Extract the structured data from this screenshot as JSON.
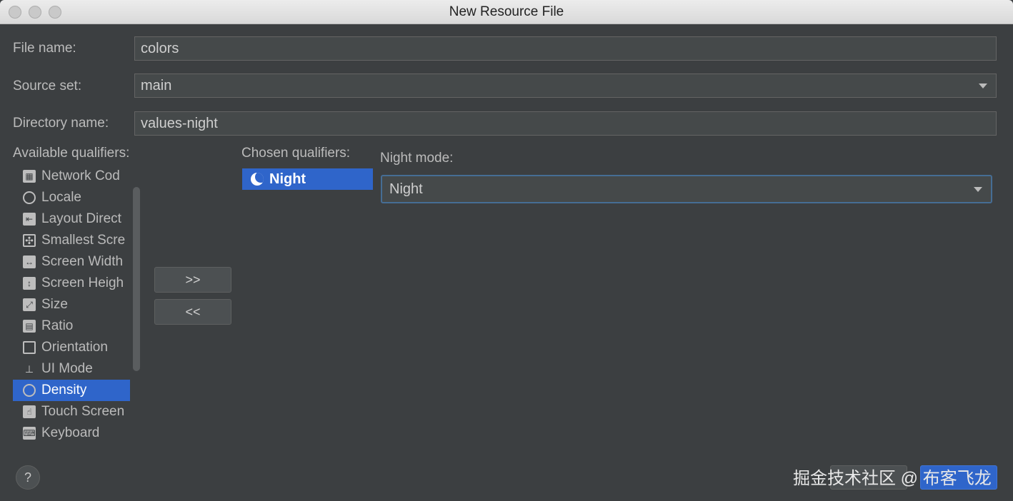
{
  "window": {
    "title": "New Resource File"
  },
  "form": {
    "file_name_label": "File name:",
    "file_name_value": "colors",
    "source_set_label": "Source set:",
    "source_set_value": "main",
    "directory_name_label": "Directory name:",
    "directory_name_value": "values-night"
  },
  "available": {
    "label": "Available qualifiers:",
    "items": [
      {
        "label": "Network Cod",
        "icon": "network-icon"
      },
      {
        "label": "Locale",
        "icon": "globe-icon"
      },
      {
        "label": "Layout Direct",
        "icon": "layout-direction-icon"
      },
      {
        "label": "Smallest Scre",
        "icon": "smallest-screen-icon"
      },
      {
        "label": "Screen Width",
        "icon": "screen-width-icon"
      },
      {
        "label": "Screen Heigh",
        "icon": "screen-height-icon"
      },
      {
        "label": "Size",
        "icon": "size-icon"
      },
      {
        "label": "Ratio",
        "icon": "ratio-icon"
      },
      {
        "label": "Orientation",
        "icon": "orientation-icon"
      },
      {
        "label": "UI Mode",
        "icon": "ui-mode-icon"
      },
      {
        "label": "Density",
        "icon": "density-icon",
        "selected": true
      },
      {
        "label": "Touch Screen",
        "icon": "touch-screen-icon"
      },
      {
        "label": "Keyboard",
        "icon": "keyboard-icon"
      }
    ]
  },
  "buttons": {
    "add": ">>",
    "remove": "<<"
  },
  "chosen": {
    "label": "Chosen qualifiers:",
    "items": [
      {
        "label": "Night",
        "icon": "moon-icon"
      }
    ]
  },
  "night_mode": {
    "label": "Night mode:",
    "value": "Night"
  },
  "help": {
    "label": "?"
  },
  "watermark": "掘金技术社区 @ 布客飞龙",
  "colors": {
    "background": "#3c3f41",
    "selection": "#2f65ca",
    "field": "#45494a"
  }
}
